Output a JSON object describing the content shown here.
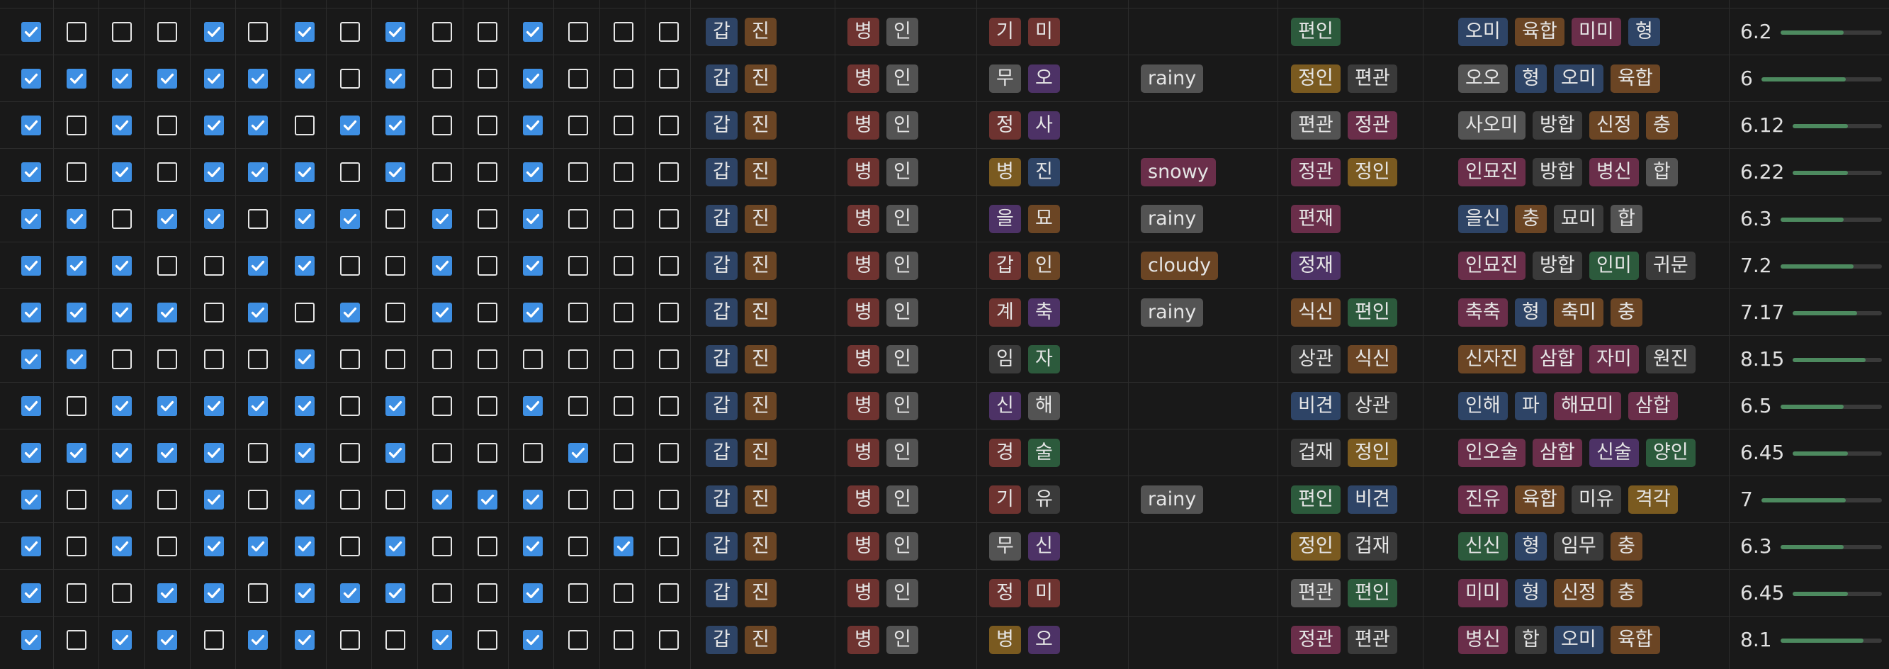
{
  "colors": {
    "blue": "#2e4466",
    "brown": "#6b4524",
    "red": "#6e3330",
    "gray": "#535353",
    "purple": "#4d3266",
    "pink": "#6a2e4a",
    "green": "#2c5a3c",
    "orange": "#7a5a20",
    "dark": "#3a3a3a",
    "check": "#3e8fe3",
    "bar": "#4d8a5f"
  },
  "rows": [
    {
      "checks": [
        1,
        0,
        0,
        0,
        1,
        0,
        1,
        0,
        1,
        0,
        0,
        1,
        0,
        0,
        0
      ],
      "g1": [
        [
          "갑",
          "blue"
        ],
        [
          "진",
          "brown"
        ]
      ],
      "g2": [
        [
          "병",
          "red"
        ],
        [
          "인",
          "gray"
        ]
      ],
      "g3": [
        [
          "기",
          "red"
        ],
        [
          "미",
          "red"
        ]
      ],
      "weather": null,
      "g4": [
        [
          "편인",
          "green"
        ]
      ],
      "g5": [
        [
          "오미",
          "blue"
        ],
        [
          "육합",
          "brown"
        ],
        [
          "미미",
          "pink"
        ],
        [
          "형",
          "blue"
        ]
      ],
      "score": "6.2",
      "level": 0.62
    },
    {
      "checks": [
        1,
        1,
        1,
        1,
        1,
        1,
        1,
        0,
        1,
        0,
        0,
        1,
        0,
        0,
        0
      ],
      "g1": [
        [
          "갑",
          "blue"
        ],
        [
          "진",
          "brown"
        ]
      ],
      "g2": [
        [
          "병",
          "red"
        ],
        [
          "인",
          "gray"
        ]
      ],
      "g3": [
        [
          "무",
          "gray"
        ],
        [
          "오",
          "purple"
        ]
      ],
      "weather": [
        "rainy",
        "gray"
      ],
      "g4": [
        [
          "정인",
          "orange"
        ],
        [
          "편관",
          "dark"
        ]
      ],
      "g5": [
        [
          "오오",
          "gray"
        ],
        [
          "형",
          "blue"
        ],
        [
          "오미",
          "blue"
        ],
        [
          "육합",
          "brown"
        ]
      ],
      "score": "6",
      "level": 0.7
    },
    {
      "checks": [
        1,
        0,
        1,
        0,
        1,
        1,
        0,
        1,
        1,
        0,
        0,
        1,
        0,
        0,
        0
      ],
      "g1": [
        [
          "갑",
          "blue"
        ],
        [
          "진",
          "brown"
        ]
      ],
      "g2": [
        [
          "병",
          "red"
        ],
        [
          "인",
          "gray"
        ]
      ],
      "g3": [
        [
          "정",
          "red"
        ],
        [
          "사",
          "purple"
        ]
      ],
      "weather": null,
      "g4": [
        [
          "편관",
          "gray"
        ],
        [
          "정관",
          "pink"
        ]
      ],
      "g5": [
        [
          "사오미",
          "gray"
        ],
        [
          "방합",
          "dark"
        ],
        [
          "신정",
          "brown"
        ],
        [
          "충",
          "brown"
        ]
      ],
      "score": "6.12",
      "level": 0.62
    },
    {
      "checks": [
        1,
        0,
        1,
        0,
        1,
        1,
        1,
        0,
        1,
        0,
        0,
        1,
        0,
        0,
        0
      ],
      "g1": [
        [
          "갑",
          "blue"
        ],
        [
          "진",
          "brown"
        ]
      ],
      "g2": [
        [
          "병",
          "red"
        ],
        [
          "인",
          "gray"
        ]
      ],
      "g3": [
        [
          "병",
          "orange"
        ],
        [
          "진",
          "blue"
        ]
      ],
      "weather": [
        "snowy",
        "pink"
      ],
      "g4": [
        [
          "정관",
          "pink"
        ],
        [
          "정인",
          "orange"
        ]
      ],
      "g5": [
        [
          "인묘진",
          "pink"
        ],
        [
          "방합",
          "dark"
        ],
        [
          "병신",
          "pink"
        ],
        [
          "합",
          "gray"
        ]
      ],
      "score": "6.22",
      "level": 0.62
    },
    {
      "checks": [
        1,
        1,
        0,
        1,
        1,
        0,
        1,
        1,
        0,
        1,
        0,
        1,
        0,
        0,
        0
      ],
      "g1": [
        [
          "갑",
          "blue"
        ],
        [
          "진",
          "brown"
        ]
      ],
      "g2": [
        [
          "병",
          "red"
        ],
        [
          "인",
          "gray"
        ]
      ],
      "g3": [
        [
          "을",
          "purple"
        ],
        [
          "묘",
          "brown"
        ]
      ],
      "weather": [
        "rainy",
        "gray"
      ],
      "g4": [
        [
          "편재",
          "pink"
        ]
      ],
      "g5": [
        [
          "을신",
          "blue"
        ],
        [
          "충",
          "brown"
        ],
        [
          "묘미",
          "dark"
        ],
        [
          "합",
          "gray"
        ]
      ],
      "score": "6.3",
      "level": 0.62
    },
    {
      "checks": [
        1,
        1,
        1,
        0,
        0,
        1,
        1,
        0,
        0,
        1,
        0,
        1,
        0,
        0,
        0
      ],
      "g1": [
        [
          "갑",
          "blue"
        ],
        [
          "진",
          "brown"
        ]
      ],
      "g2": [
        [
          "병",
          "red"
        ],
        [
          "인",
          "gray"
        ]
      ],
      "g3": [
        [
          "갑",
          "red"
        ],
        [
          "인",
          "brown"
        ]
      ],
      "weather": [
        "cloudy",
        "brown"
      ],
      "g4": [
        [
          "정재",
          "purple"
        ]
      ],
      "g5": [
        [
          "인묘진",
          "pink"
        ],
        [
          "방합",
          "dark"
        ],
        [
          "인미",
          "green"
        ],
        [
          "귀문",
          "dark"
        ]
      ],
      "score": "7.2",
      "level": 0.72
    },
    {
      "checks": [
        1,
        1,
        1,
        1,
        0,
        1,
        0,
        1,
        0,
        1,
        0,
        1,
        0,
        0,
        0
      ],
      "g1": [
        [
          "갑",
          "blue"
        ],
        [
          "진",
          "brown"
        ]
      ],
      "g2": [
        [
          "병",
          "red"
        ],
        [
          "인",
          "gray"
        ]
      ],
      "g3": [
        [
          "계",
          "red"
        ],
        [
          "축",
          "purple"
        ]
      ],
      "weather": [
        "rainy",
        "gray"
      ],
      "g4": [
        [
          "식신",
          "brown"
        ],
        [
          "편인",
          "green"
        ]
      ],
      "g5": [
        [
          "축축",
          "pink"
        ],
        [
          "형",
          "blue"
        ],
        [
          "축미",
          "brown"
        ],
        [
          "충",
          "brown"
        ]
      ],
      "score": "7.17",
      "level": 0.72
    },
    {
      "checks": [
        1,
        1,
        0,
        0,
        0,
        0,
        1,
        0,
        0,
        0,
        0,
        0,
        0,
        0,
        0
      ],
      "g1": [
        [
          "갑",
          "blue"
        ],
        [
          "진",
          "brown"
        ]
      ],
      "g2": [
        [
          "병",
          "red"
        ],
        [
          "인",
          "gray"
        ]
      ],
      "g3": [
        [
          "임",
          "dark"
        ],
        [
          "자",
          "green"
        ]
      ],
      "weather": null,
      "g4": [
        [
          "상관",
          "dark"
        ],
        [
          "식신",
          "brown"
        ]
      ],
      "g5": [
        [
          "신자진",
          "brown"
        ],
        [
          "삼합",
          "pink"
        ],
        [
          "자미",
          "pink"
        ],
        [
          "원진",
          "dark"
        ]
      ],
      "score": "8.15",
      "level": 0.82
    },
    {
      "checks": [
        1,
        0,
        1,
        1,
        1,
        1,
        1,
        0,
        1,
        0,
        0,
        1,
        0,
        0,
        0
      ],
      "g1": [
        [
          "갑",
          "blue"
        ],
        [
          "진",
          "brown"
        ]
      ],
      "g2": [
        [
          "병",
          "red"
        ],
        [
          "인",
          "gray"
        ]
      ],
      "g3": [
        [
          "신",
          "purple"
        ],
        [
          "해",
          "gray"
        ]
      ],
      "weather": null,
      "g4": [
        [
          "비견",
          "blue"
        ],
        [
          "상관",
          "dark"
        ]
      ],
      "g5": [
        [
          "인해",
          "blue"
        ],
        [
          "파",
          "blue"
        ],
        [
          "해묘미",
          "pink"
        ],
        [
          "삼합",
          "pink"
        ]
      ],
      "score": "6.5",
      "level": 0.62
    },
    {
      "checks": [
        1,
        1,
        1,
        1,
        1,
        0,
        1,
        0,
        1,
        0,
        0,
        0,
        1,
        0,
        0
      ],
      "g1": [
        [
          "갑",
          "blue"
        ],
        [
          "진",
          "brown"
        ]
      ],
      "g2": [
        [
          "병",
          "red"
        ],
        [
          "인",
          "gray"
        ]
      ],
      "g3": [
        [
          "경",
          "red"
        ],
        [
          "술",
          "green"
        ]
      ],
      "weather": null,
      "g4": [
        [
          "겁재",
          "dark"
        ],
        [
          "정인",
          "orange"
        ]
      ],
      "g5": [
        [
          "인오술",
          "pink"
        ],
        [
          "삼합",
          "pink"
        ],
        [
          "신술",
          "purple"
        ],
        [
          "양인",
          "green"
        ]
      ],
      "score": "6.45",
      "level": 0.62
    },
    {
      "checks": [
        1,
        0,
        1,
        0,
        1,
        0,
        1,
        0,
        0,
        1,
        1,
        1,
        0,
        0,
        0
      ],
      "g1": [
        [
          "갑",
          "blue"
        ],
        [
          "진",
          "brown"
        ]
      ],
      "g2": [
        [
          "병",
          "red"
        ],
        [
          "인",
          "gray"
        ]
      ],
      "g3": [
        [
          "기",
          "red"
        ],
        [
          "유",
          "dark"
        ]
      ],
      "weather": [
        "rainy",
        "gray"
      ],
      "g4": [
        [
          "편인",
          "green"
        ],
        [
          "비견",
          "blue"
        ]
      ],
      "g5": [
        [
          "진유",
          "pink"
        ],
        [
          "육합",
          "brown"
        ],
        [
          "미유",
          "dark"
        ],
        [
          "격각",
          "orange"
        ]
      ],
      "score": "7",
      "level": 0.7
    },
    {
      "checks": [
        1,
        0,
        1,
        0,
        1,
        1,
        1,
        0,
        1,
        0,
        0,
        1,
        0,
        1,
        0
      ],
      "g1": [
        [
          "갑",
          "blue"
        ],
        [
          "진",
          "brown"
        ]
      ],
      "g2": [
        [
          "병",
          "red"
        ],
        [
          "인",
          "gray"
        ]
      ],
      "g3": [
        [
          "무",
          "gray"
        ],
        [
          "신",
          "purple"
        ]
      ],
      "weather": null,
      "g4": [
        [
          "정인",
          "orange"
        ],
        [
          "겁재",
          "dark"
        ]
      ],
      "g5": [
        [
          "신신",
          "green"
        ],
        [
          "형",
          "blue"
        ],
        [
          "임무",
          "dark"
        ],
        [
          "충",
          "brown"
        ]
      ],
      "score": "6.3",
      "level": 0.62
    },
    {
      "checks": [
        1,
        0,
        0,
        1,
        1,
        0,
        1,
        1,
        1,
        0,
        0,
        1,
        0,
        0,
        0
      ],
      "g1": [
        [
          "갑",
          "blue"
        ],
        [
          "진",
          "brown"
        ]
      ],
      "g2": [
        [
          "병",
          "red"
        ],
        [
          "인",
          "gray"
        ]
      ],
      "g3": [
        [
          "정",
          "red"
        ],
        [
          "미",
          "red"
        ]
      ],
      "weather": null,
      "g4": [
        [
          "편관",
          "gray"
        ],
        [
          "편인",
          "green"
        ]
      ],
      "g5": [
        [
          "미미",
          "pink"
        ],
        [
          "형",
          "blue"
        ],
        [
          "신정",
          "brown"
        ],
        [
          "충",
          "brown"
        ]
      ],
      "score": "6.45",
      "level": 0.62
    },
    {
      "checks": [
        1,
        0,
        1,
        1,
        0,
        1,
        1,
        0,
        0,
        1,
        0,
        1,
        0,
        0,
        0
      ],
      "g1": [
        [
          "갑",
          "blue"
        ],
        [
          "진",
          "brown"
        ]
      ],
      "g2": [
        [
          "병",
          "red"
        ],
        [
          "인",
          "gray"
        ]
      ],
      "g3": [
        [
          "병",
          "orange"
        ],
        [
          "오",
          "purple"
        ]
      ],
      "weather": null,
      "g4": [
        [
          "정관",
          "pink"
        ],
        [
          "편관",
          "dark"
        ]
      ],
      "g5": [
        [
          "병신",
          "pink"
        ],
        [
          "합",
          "dark"
        ],
        [
          "오미",
          "blue"
        ],
        [
          "육합",
          "brown"
        ]
      ],
      "score": "8.1",
      "level": 0.82
    }
  ]
}
